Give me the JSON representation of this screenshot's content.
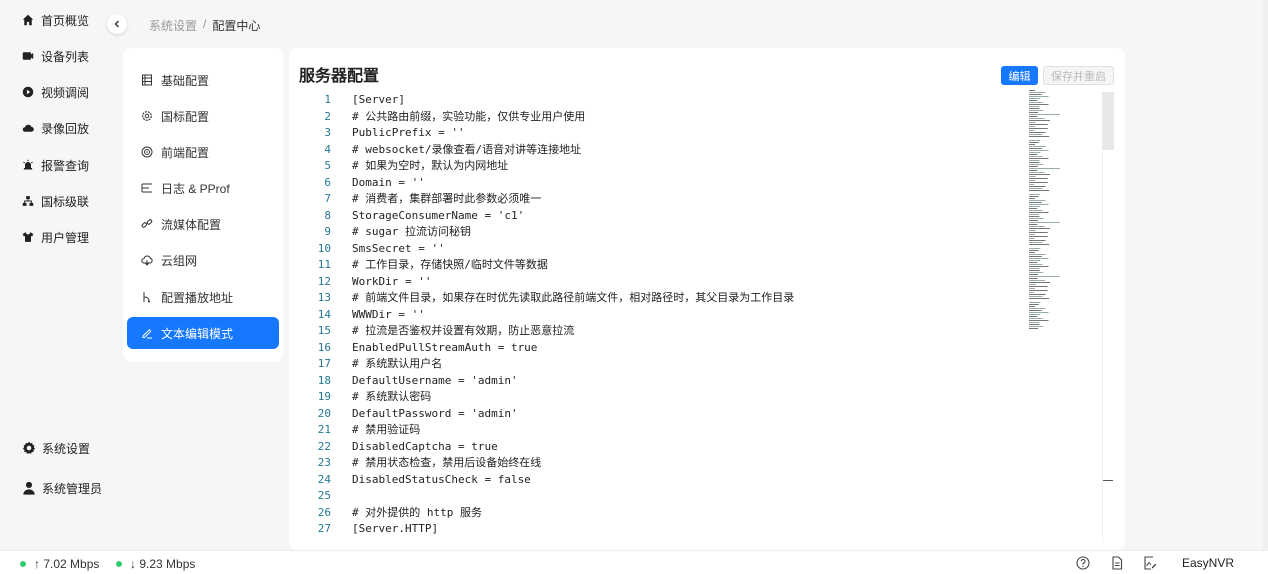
{
  "nav": {
    "items": [
      {
        "label": "首页概览",
        "icon": "home-icon"
      },
      {
        "label": "设备列表",
        "icon": "device-icon"
      },
      {
        "label": "视频调阅",
        "icon": "play-icon"
      },
      {
        "label": "录像回放",
        "icon": "cloud-icon"
      },
      {
        "label": "报警查询",
        "icon": "alarm-icon"
      },
      {
        "label": "国标级联",
        "icon": "cascade-icon"
      },
      {
        "label": "用户管理",
        "icon": "user-shirt-icon"
      }
    ],
    "bottom": [
      {
        "label": "系统设置",
        "icon": "gear-icon"
      },
      {
        "label": "系统管理员",
        "icon": "admin-icon"
      }
    ]
  },
  "breadcrumb": {
    "parent": "系统设置",
    "separator": "/",
    "current": "配置中心"
  },
  "subnav": {
    "items": [
      {
        "label": "基础配置",
        "icon": "base-config-icon"
      },
      {
        "label": "国标配置",
        "icon": "gear-outline-icon"
      },
      {
        "label": "前端配置",
        "icon": "frontend-icon"
      },
      {
        "label": "日志 & PProf",
        "icon": "log-icon"
      },
      {
        "label": "流媒体配置",
        "icon": "link-icon"
      },
      {
        "label": "云组网",
        "icon": "cloud-network-icon"
      },
      {
        "label": "配置播放地址",
        "icon": "branch-icon"
      },
      {
        "label": "文本编辑模式",
        "icon": "edit-icon"
      }
    ],
    "active_index": 7
  },
  "panel": {
    "title": "服务器配置",
    "edit_label": "编辑",
    "save_label": "保存并重启"
  },
  "code": [
    {
      "n": "1",
      "t": "[Server]"
    },
    {
      "n": "2",
      "t": "# 公共路由前缀，实验功能，仅供专业用户使用"
    },
    {
      "n": "3",
      "t": "PublicPrefix = ''"
    },
    {
      "n": "4",
      "t": "# websocket/录像查看/语音对讲等连接地址"
    },
    {
      "n": "5",
      "t": "# 如果为空时，默认为内网地址"
    },
    {
      "n": "6",
      "t": "Domain = ''"
    },
    {
      "n": "7",
      "t": "# 消费者，集群部署时此参数必须唯一"
    },
    {
      "n": "8",
      "t": "StorageConsumerName = 'c1'"
    },
    {
      "n": "9",
      "t": "# sugar 拉流访问秘钥"
    },
    {
      "n": "10",
      "t": "SmsSecret = ''"
    },
    {
      "n": "11",
      "t": "# 工作目录，存储快照/临时文件等数据"
    },
    {
      "n": "12",
      "t": "WorkDir = ''"
    },
    {
      "n": "13",
      "t": "# 前端文件目录，如果存在时优先读取此路径前端文件，相对路径时，其父目录为工作目录"
    },
    {
      "n": "14",
      "t": "WWWDir = ''"
    },
    {
      "n": "15",
      "t": "# 拉流是否鉴权并设置有效期，防止恶意拉流"
    },
    {
      "n": "16",
      "t": "EnabledPullStreamAuth = true"
    },
    {
      "n": "17",
      "t": "# 系统默认用户名"
    },
    {
      "n": "18",
      "t": "DefaultUsername = 'admin'"
    },
    {
      "n": "19",
      "t": "# 系统默认密码"
    },
    {
      "n": "20",
      "t": "DefaultPassword = 'admin'"
    },
    {
      "n": "21",
      "t": "# 禁用验证码"
    },
    {
      "n": "22",
      "t": "DisabledCaptcha = true"
    },
    {
      "n": "23",
      "t": "# 禁用状态检查，禁用后设备始终在线"
    },
    {
      "n": "24",
      "t": "DisabledStatusCheck = false"
    },
    {
      "n": "25",
      "t": ""
    },
    {
      "n": "26",
      "t": "# 对外提供的 http 服务"
    },
    {
      "n": "27",
      "t": "[Server.HTTP]"
    }
  ],
  "status": {
    "upload": "↑ 7.02 Mbps",
    "download": "↓ 9.23 Mbps",
    "brand": "EasyNVR",
    "online_color": "#2ecc71",
    "accent": "#1677ff"
  }
}
